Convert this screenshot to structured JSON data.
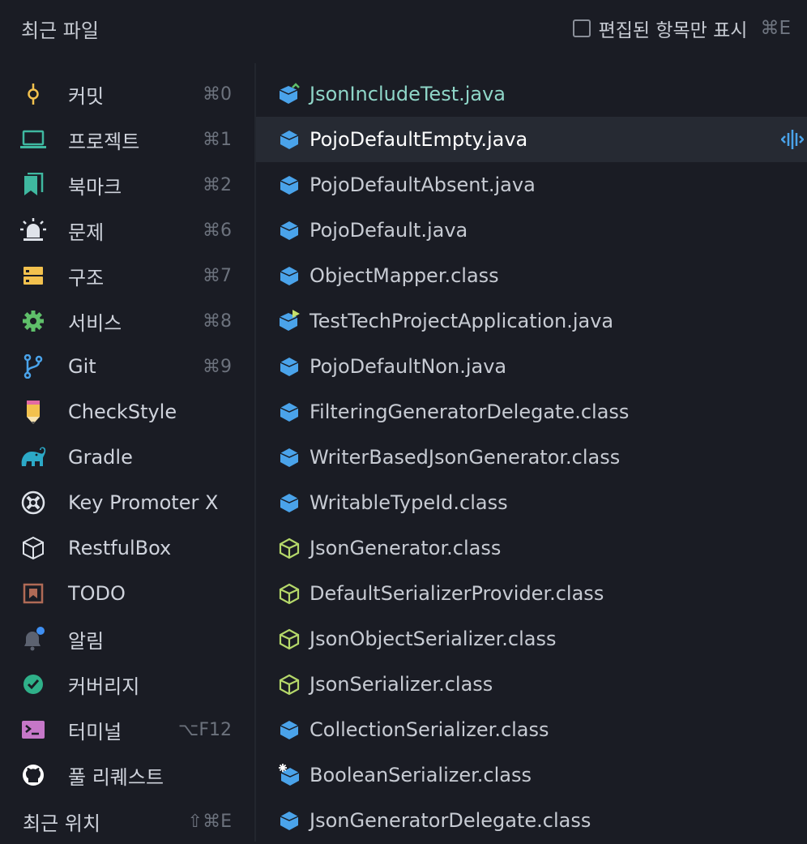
{
  "header": {
    "title": "최근 파일",
    "edited_only_label": "편집된 항목만 표시",
    "edited_only_shortcut": "⌘E",
    "edited_only_checked": false
  },
  "tool_windows": [
    {
      "label": "커밋",
      "shortcut": "⌘0",
      "icon": "commit-icon",
      "color": "#f2c14e"
    },
    {
      "label": "프로젝트",
      "shortcut": "⌘1",
      "icon": "project-laptop-icon",
      "color": "#3fb8a0"
    },
    {
      "label": "북마크",
      "shortcut": "⌘2",
      "icon": "bookmarks-icon",
      "color": "#3fb8a0"
    },
    {
      "label": "문제",
      "shortcut": "⌘6",
      "icon": "problems-alarm-icon",
      "color": "#dfe3ea"
    },
    {
      "label": "구조",
      "shortcut": "⌘7",
      "icon": "structure-icon",
      "color": "#f2c14e"
    },
    {
      "label": "서비스",
      "shortcut": "⌘8",
      "icon": "services-gear-icon",
      "color": "#5fbf6a"
    },
    {
      "label": "Git",
      "shortcut": "⌘9",
      "icon": "git-branch-icon",
      "color": "#4aa3ea"
    },
    {
      "label": "CheckStyle",
      "shortcut": "",
      "icon": "pencil-icon",
      "color": "#f2c14e"
    },
    {
      "label": "Gradle",
      "shortcut": "",
      "icon": "elephant-icon",
      "color": "#2ca9c7"
    },
    {
      "label": "Key Promoter X",
      "shortcut": "",
      "icon": "key-promoter-icon",
      "color": "#dfe3ea"
    },
    {
      "label": "RestfulBox",
      "shortcut": "",
      "icon": "cube-icon",
      "color": "#dfe3ea"
    },
    {
      "label": "TODO",
      "shortcut": "",
      "icon": "todo-icon",
      "color": "#b06a56"
    },
    {
      "label": "알림",
      "shortcut": "",
      "icon": "bell-icon",
      "color": "#5c6270"
    },
    {
      "label": "커버리지",
      "shortcut": "",
      "icon": "coverage-icon",
      "color": "#2fb089"
    },
    {
      "label": "터미널",
      "shortcut": "⌥F12",
      "icon": "terminal-icon",
      "color": "#c677c8"
    },
    {
      "label": "풀 리퀘스트",
      "shortcut": "",
      "icon": "github-icon",
      "color": "#ffffff"
    }
  ],
  "recent_locations": {
    "label": "최근 위치",
    "shortcut": "⇧⌘E"
  },
  "files": [
    {
      "name": "JsonIncludeTest.java",
      "type": "java-test",
      "modified": true,
      "selected": false
    },
    {
      "name": "PojoDefaultEmpty.java",
      "type": "java",
      "modified": false,
      "selected": true
    },
    {
      "name": "PojoDefaultAbsent.java",
      "type": "java",
      "modified": false,
      "selected": false
    },
    {
      "name": "PojoDefault.java",
      "type": "java",
      "modified": false,
      "selected": false
    },
    {
      "name": "ObjectMapper.class",
      "type": "class",
      "modified": false,
      "selected": false
    },
    {
      "name": "TestTechProjectApplication.java",
      "type": "java-run",
      "modified": false,
      "selected": false
    },
    {
      "name": "PojoDefaultNon.java",
      "type": "java",
      "modified": false,
      "selected": false
    },
    {
      "name": "FilteringGeneratorDelegate.class",
      "type": "class",
      "modified": false,
      "selected": false
    },
    {
      "name": "WriterBasedJsonGenerator.class",
      "type": "class",
      "modified": false,
      "selected": false
    },
    {
      "name": "WritableTypeId.class",
      "type": "class",
      "modified": false,
      "selected": false
    },
    {
      "name": "JsonGenerator.class",
      "type": "abstract-class",
      "modified": false,
      "selected": false
    },
    {
      "name": "DefaultSerializerProvider.class",
      "type": "abstract-class",
      "modified": false,
      "selected": false
    },
    {
      "name": "JsonObjectSerializer.class",
      "type": "abstract-class",
      "modified": false,
      "selected": false
    },
    {
      "name": "JsonSerializer.class",
      "type": "abstract-class",
      "modified": false,
      "selected": false
    },
    {
      "name": "CollectionSerializer.class",
      "type": "class",
      "modified": false,
      "selected": false
    },
    {
      "name": "BooleanSerializer.class",
      "type": "class-static",
      "modified": false,
      "selected": false
    },
    {
      "name": "JsonGeneratorDelegate.class",
      "type": "class",
      "modified": false,
      "selected": false
    }
  ],
  "colors": {
    "background": "#1a1c24",
    "selected_row": "#262a33",
    "class_icon": "#4aa3ea",
    "abstract_icon": "#b5d86a",
    "modified_text": "#8fd6c8"
  }
}
